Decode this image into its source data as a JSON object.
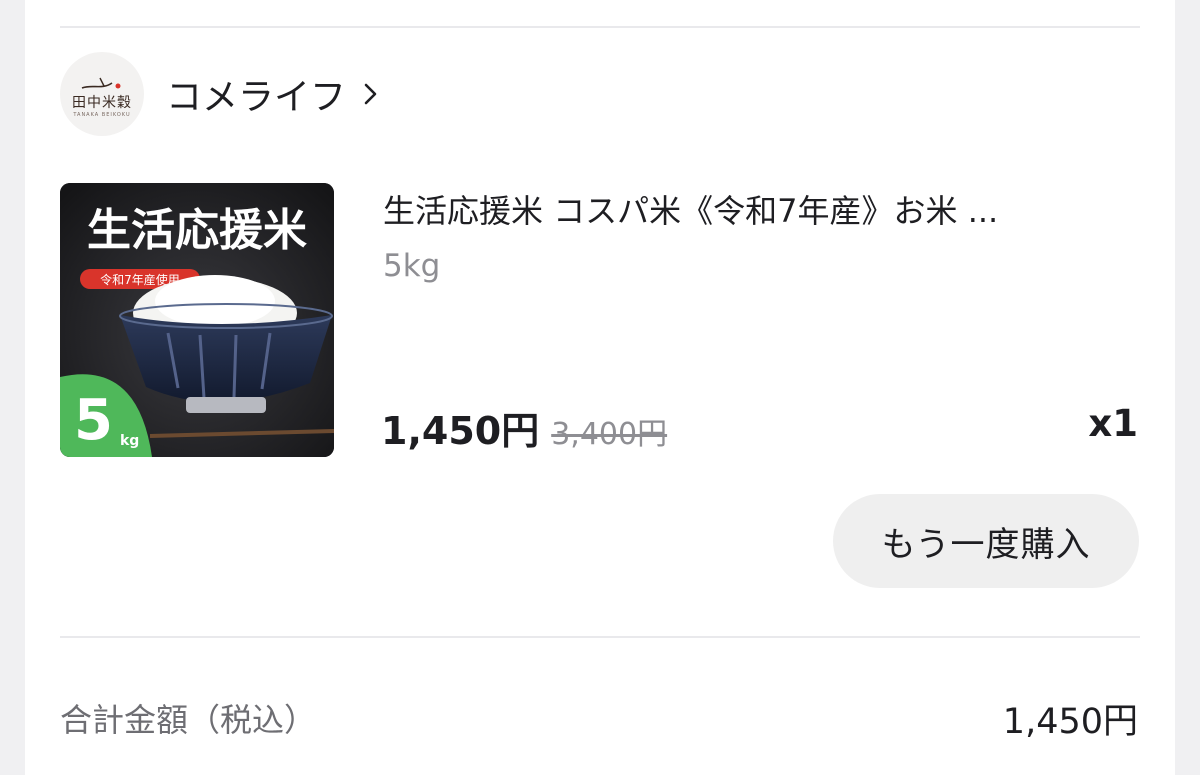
{
  "shop": {
    "name": "コメライフ",
    "logo_text": "田中米穀",
    "logo_sub": "TANAKA BEIKOKU"
  },
  "product": {
    "title": "生活応援米 コスパ米《令和7年産》お米 ...",
    "variant": "5kg",
    "price": "1,450円",
    "original_price": "3,400円",
    "quantity": "x1",
    "image": {
      "headline": "生活応援米",
      "badge": "令和7年産使用",
      "weight_number": "5",
      "weight_unit": "kg"
    }
  },
  "actions": {
    "rebuy_label": "もう一度購入"
  },
  "summary": {
    "total_label": "合計金額（税込）",
    "total_value": "1,450円"
  },
  "colors": {
    "background": "#f0f0f2",
    "card": "#ffffff",
    "text_primary": "#1e1e22",
    "text_secondary": "#8e8e93",
    "button_bg": "#efefef",
    "image_green": "#4fb85a",
    "image_badge_red": "#d9342b"
  },
  "icons": {
    "chevron": "chevron-right-icon"
  }
}
